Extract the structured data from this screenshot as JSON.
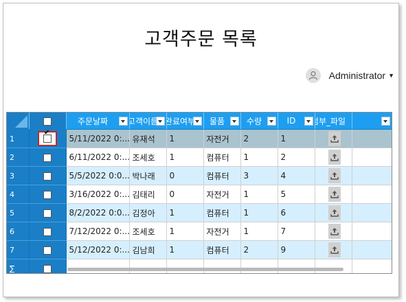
{
  "page": {
    "title": "고객주문 목록"
  },
  "user": {
    "name": "Administrator"
  },
  "grid": {
    "columns": [
      {
        "label": "주문날짜"
      },
      {
        "label": "고객이름"
      },
      {
        "label": "완료여부"
      },
      {
        "label": "물품"
      },
      {
        "label": "수량"
      },
      {
        "label": "ID"
      },
      {
        "label": "첨부_파일"
      },
      {
        "label": ""
      }
    ],
    "rows": [
      {
        "num": "1",
        "checked": true,
        "date": "5/11/2022 0:...",
        "name": "유재석",
        "done": "1",
        "item": "자전거",
        "qty": "2",
        "id": "1"
      },
      {
        "num": "2",
        "checked": false,
        "date": "6/11/2022 0:...",
        "name": "조세호",
        "done": "1",
        "item": "컴퓨터",
        "qty": "1",
        "id": "2"
      },
      {
        "num": "3",
        "checked": false,
        "date": "5/5/2022 0:0...",
        "name": "박나래",
        "done": "0",
        "item": "컴퓨터",
        "qty": "3",
        "id": "4"
      },
      {
        "num": "4",
        "checked": false,
        "date": "3/16/2022 0:...",
        "name": "김태리",
        "done": "0",
        "item": "자전거",
        "qty": "1",
        "id": "5"
      },
      {
        "num": "5",
        "checked": false,
        "date": "8/2/2022 0:0...",
        "name": "김정아",
        "done": "1",
        "item": "컴퓨터",
        "qty": "1",
        "id": "6"
      },
      {
        "num": "6",
        "checked": false,
        "date": "7/12/2022 0:...",
        "name": "조세호",
        "done": "1",
        "item": "자전거",
        "qty": "1",
        "id": "7"
      },
      {
        "num": "7",
        "checked": false,
        "date": "5/12/2022 0:...",
        "name": "김남희",
        "done": "1",
        "item": "컴퓨터",
        "qty": "2",
        "id": "9"
      }
    ],
    "summary_label": "∑"
  },
  "colors": {
    "header": "#1e9ef0",
    "row_header": "#1a7fc7",
    "alt_row": "#d6efff",
    "selected_row": "#a9c3cf",
    "highlight_border": "#c0282e"
  },
  "icons": {
    "user": "user-avatar-icon",
    "filter": "filter-dropdown-icon",
    "upload": "upload-icon"
  }
}
